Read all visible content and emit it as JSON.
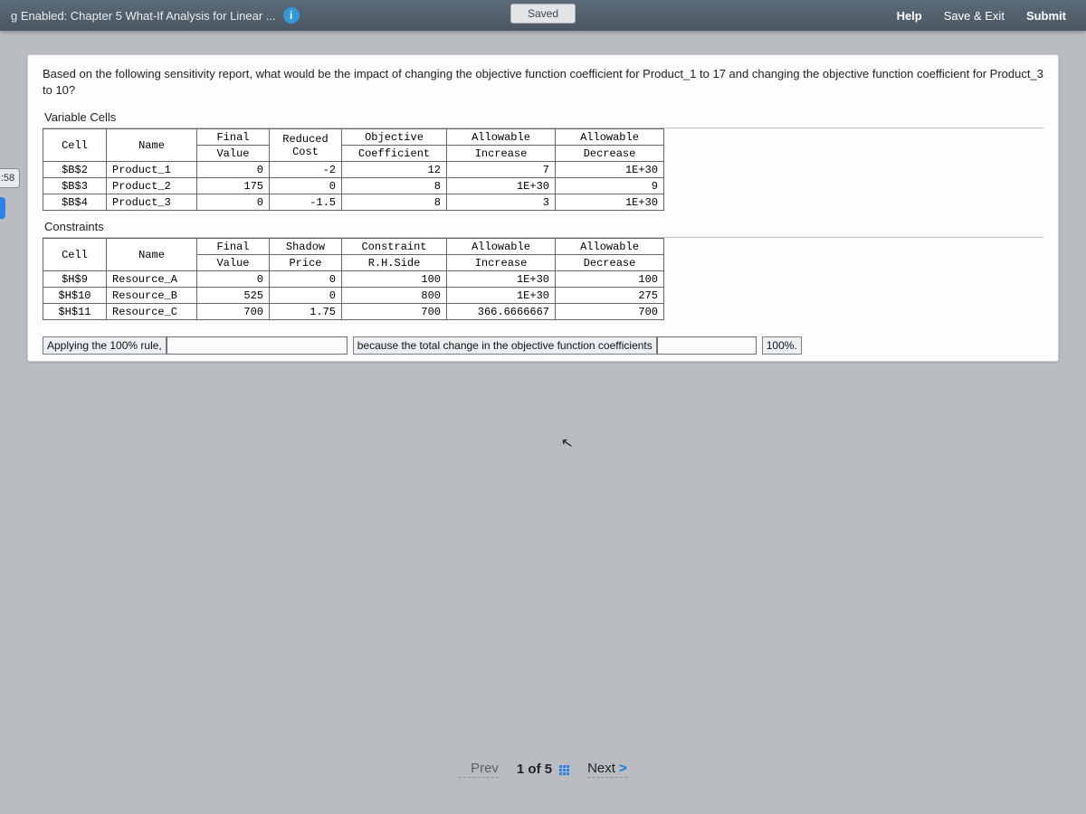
{
  "topbar": {
    "title": "g Enabled: Chapter 5 What-If Analysis for Linear ...",
    "info_glyph": "i",
    "saved": "Saved",
    "help": "Help",
    "save_exit": "Save & Exit",
    "submit": "Submit"
  },
  "timer": ":58",
  "question": "Based on the following sensitivity report, what would be the impact of changing the objective function coefficient for Product_1 to 17 and changing the objective function coefficient for Product_3 to 10?",
  "var_section": "Variable Cells",
  "con_section": "Constraints",
  "var_headers": {
    "cell": "Cell",
    "name": "Name",
    "fv1": "Final",
    "fv2": "Value",
    "rc1": "Reduced Cost",
    "rc2": "",
    "oc1": "Objective",
    "oc2": "Coefficient",
    "ai1": "Allowable",
    "ai2": "Increase",
    "ad1": "Allowable",
    "ad2": "Decrease"
  },
  "var_rows": [
    {
      "cell": "$B$2",
      "name": "Product_1",
      "fv": "0",
      "rc": "-2",
      "oc": "12",
      "ai": "7",
      "ad": "1E+30"
    },
    {
      "cell": "$B$3",
      "name": "Product_2",
      "fv": "175",
      "rc": "0",
      "oc": "8",
      "ai": "1E+30",
      "ad": "9"
    },
    {
      "cell": "$B$4",
      "name": "Product_3",
      "fv": "0",
      "rc": "-1.5",
      "oc": "8",
      "ai": "3",
      "ad": "1E+30"
    }
  ],
  "con_headers": {
    "cell": "Cell",
    "name": "Name",
    "fv1": "Final",
    "fv2": "Value",
    "sp1": "Shadow",
    "sp2": "Price",
    "rhs1": "Constraint",
    "rhs2": "R.H.Side",
    "ai1": "Allowable",
    "ai2": "Increase",
    "ad1": "Allowable",
    "ad2": "Decrease"
  },
  "con_rows": [
    {
      "cell": "$H$9",
      "name": "Resource_A",
      "fv": "0",
      "sp": "0",
      "rhs": "100",
      "ai": "1E+30",
      "ad": "100"
    },
    {
      "cell": "$H$10",
      "name": "Resource_B",
      "fv": "525",
      "sp": "0",
      "rhs": "800",
      "ai": "1E+30",
      "ad": "275"
    },
    {
      "cell": "$H$11",
      "name": "Resource_C",
      "fv": "700",
      "sp": "1.75",
      "rhs": "700",
      "ai": "366.6666667",
      "ad": "700"
    }
  ],
  "fill": {
    "lead": "Applying the 100% rule,",
    "mid": "because the total change in the objective function coefficients",
    "tail": "100%."
  },
  "nav": {
    "prev": "Prev",
    "count": "1 of 5",
    "next": "Next"
  }
}
